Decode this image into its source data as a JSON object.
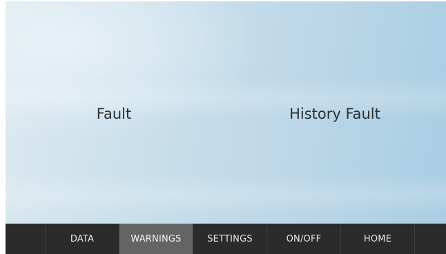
{
  "main": {
    "fault_label": "Fault",
    "history_fault_label": "History Fault"
  },
  "navbar": {
    "active_index": 1,
    "items": [
      {
        "label": "DATA"
      },
      {
        "label": "WARNINGS"
      },
      {
        "label": "SETTINGS"
      },
      {
        "label": "ON/OFF"
      },
      {
        "label": "HOME"
      }
    ],
    "colors": {
      "bar_background": "#2b2b2b",
      "active_background": "#646464",
      "text": "#e6e6e6"
    }
  }
}
